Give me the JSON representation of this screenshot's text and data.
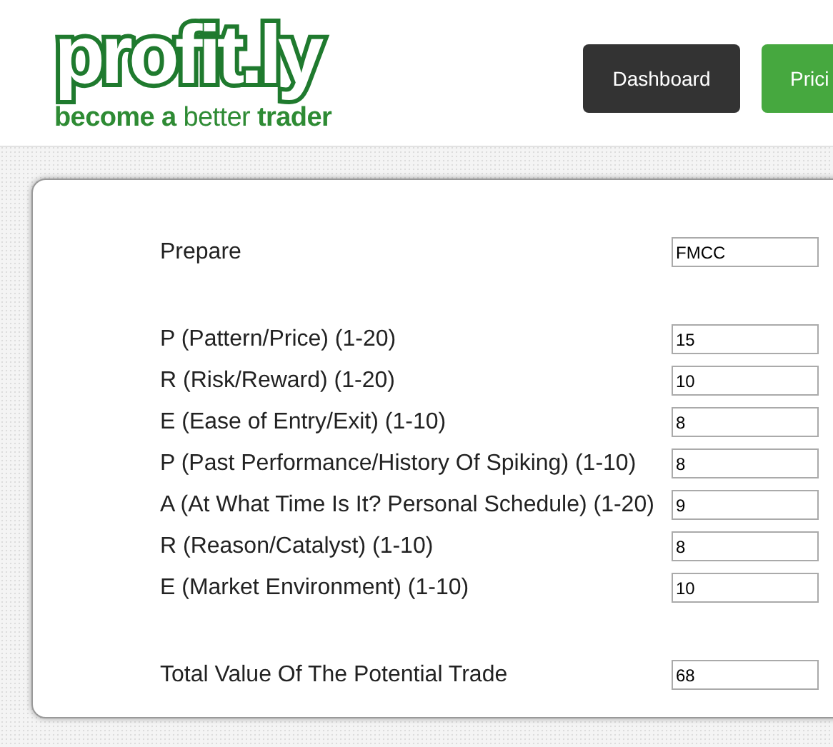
{
  "header": {
    "logo": "profit.ly",
    "tagline": "**become a** better **trader**",
    "nav": [
      {
        "label": "Dashboard",
        "kind": "dark"
      },
      {
        "label": "Prici",
        "kind": "green"
      }
    ]
  },
  "form": {
    "rows": [
      {
        "label": "Prepare",
        "value": "FMCC",
        "kind": "ticker"
      },
      {
        "label": "P (Pattern/Price) (1-20)",
        "value": "15",
        "kind": "score"
      },
      {
        "label": "R (Risk/Reward) (1-20)",
        "value": "10",
        "kind": "score"
      },
      {
        "label": "E (Ease of Entry/Exit) (1-10)",
        "value": "8",
        "kind": "score"
      },
      {
        "label": "P (Past Performance/History Of Spiking) (1-10)",
        "value": "8",
        "kind": "score"
      },
      {
        "label": "A (At What Time Is It? Personal Schedule) (1-20)",
        "value": "9",
        "kind": "score"
      },
      {
        "label": "R (Reason/Catalyst) (1-10)",
        "value": "8",
        "kind": "score"
      },
      {
        "label": "E (Market Environment) (1-10)",
        "value": "10",
        "kind": "score"
      },
      {
        "label": "Total Value Of The Potential Trade",
        "value": "68",
        "kind": "total"
      }
    ]
  }
}
